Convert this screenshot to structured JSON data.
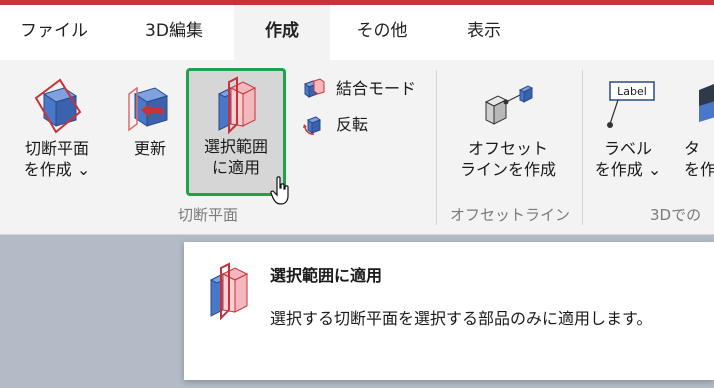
{
  "tabs": [
    {
      "label": "ファイル",
      "active": false
    },
    {
      "label": "3D編集",
      "active": false
    },
    {
      "label": "作成",
      "active": true
    },
    {
      "label": "その他",
      "active": false
    },
    {
      "label": "表示",
      "active": false
    }
  ],
  "ribbon": {
    "section_cut": {
      "group_label": "切断平面",
      "create": {
        "line1": "切断平面",
        "line2": "を作成 ⌄",
        "icon": "section-plane-cube-icon"
      },
      "update": {
        "label": "更新",
        "icon": "update-section-icon"
      },
      "apply_selection": {
        "line1": "選択範囲",
        "line2": "に適用",
        "icon": "apply-to-selection-icon"
      },
      "combine_mode": {
        "label": "結合モード",
        "icon": "combine-mode-icon"
      },
      "invert": {
        "label": "反転",
        "icon": "invert-icon"
      }
    },
    "offset_line": {
      "group_label": "オフセットライン",
      "create": {
        "line1": "オフセット",
        "line2": "ラインを作成",
        "icon": "offset-line-icon"
      }
    },
    "annotations": {
      "group_label": "3Dでの",
      "label_create": {
        "line1": "ラベル",
        "line2": "を作成 ⌄",
        "icon": "label-icon",
        "icon_text": "Label"
      },
      "partial": {
        "line1": "タ",
        "line2": "を作"
      }
    }
  },
  "tooltip": {
    "title": "選択範囲に適用",
    "description": "選択する切断平面を選択する部品のみに適用します。",
    "icon": "apply-to-selection-icon"
  },
  "colors": {
    "accent_red": "#c8323a",
    "highlight_green": "#1fa34a",
    "cube_blue": "#4a78c8",
    "plane_red": "#c8323a"
  }
}
